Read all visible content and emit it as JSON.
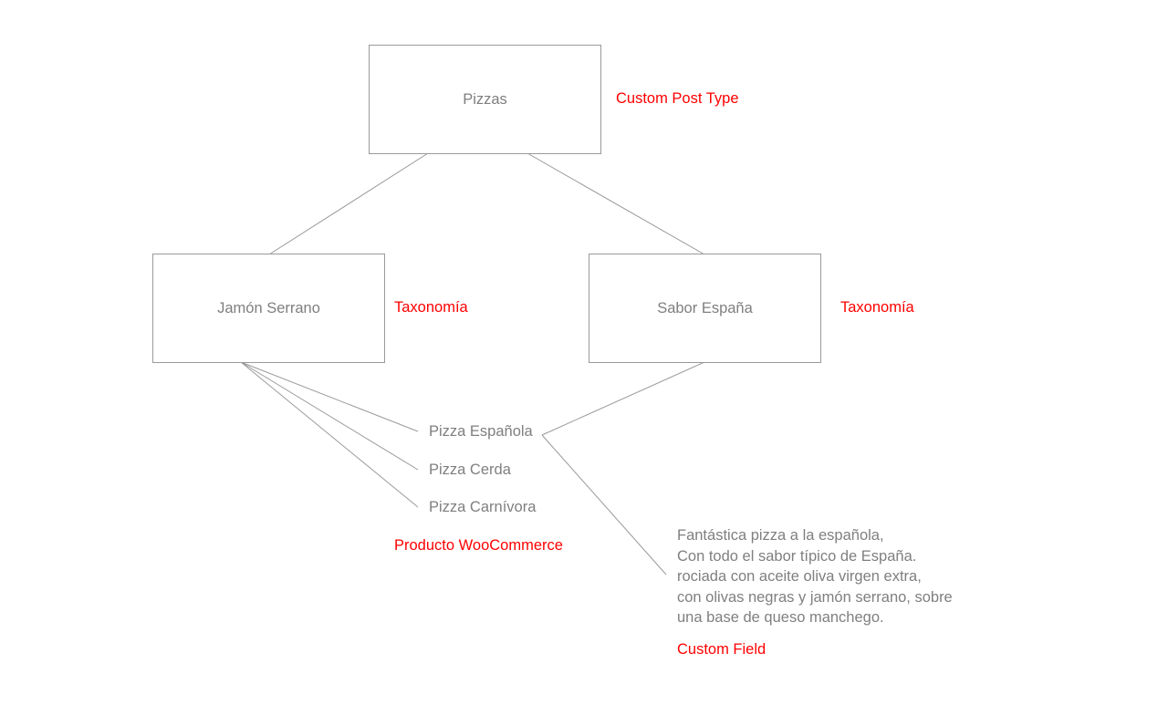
{
  "colors": {
    "node_text": "#7f7f7f",
    "node_border": "#9a9a9a",
    "annotation": "#ff0000",
    "background": "#ffffff"
  },
  "nodes": {
    "pizzas": {
      "label": "Pizzas",
      "annotation": "Custom Post Type"
    },
    "jamon_serrano": {
      "label": "Jamón Serrano",
      "annotation": "Taxonomía"
    },
    "sabor_espana": {
      "label": "Sabor España",
      "annotation": "Taxonomía"
    }
  },
  "products": {
    "items": [
      "Pizza Española",
      "Pizza Cerda",
      "Pizza Carnívora"
    ],
    "annotation": "Producto WooCommerce"
  },
  "custom_field": {
    "lines": [
      "Fantástica pizza a la española,",
      "Con todo el sabor típico de España.",
      "rociada con aceite oliva virgen extra,",
      "con olivas negras y jamón serrano, sobre",
      "una base de queso manchego."
    ],
    "annotation": "Custom Field"
  },
  "edges": [
    {
      "from": "pizzas",
      "to": "jamon_serrano"
    },
    {
      "from": "pizzas",
      "to": "sabor_espana"
    },
    {
      "from": "jamon_serrano",
      "to": "Pizza Española"
    },
    {
      "from": "jamon_serrano",
      "to": "Pizza Cerda"
    },
    {
      "from": "jamon_serrano",
      "to": "Pizza Carnívora"
    },
    {
      "from": "sabor_espana",
      "to": "Pizza Española"
    },
    {
      "from": "Pizza Española",
      "to": "custom_field"
    }
  ]
}
